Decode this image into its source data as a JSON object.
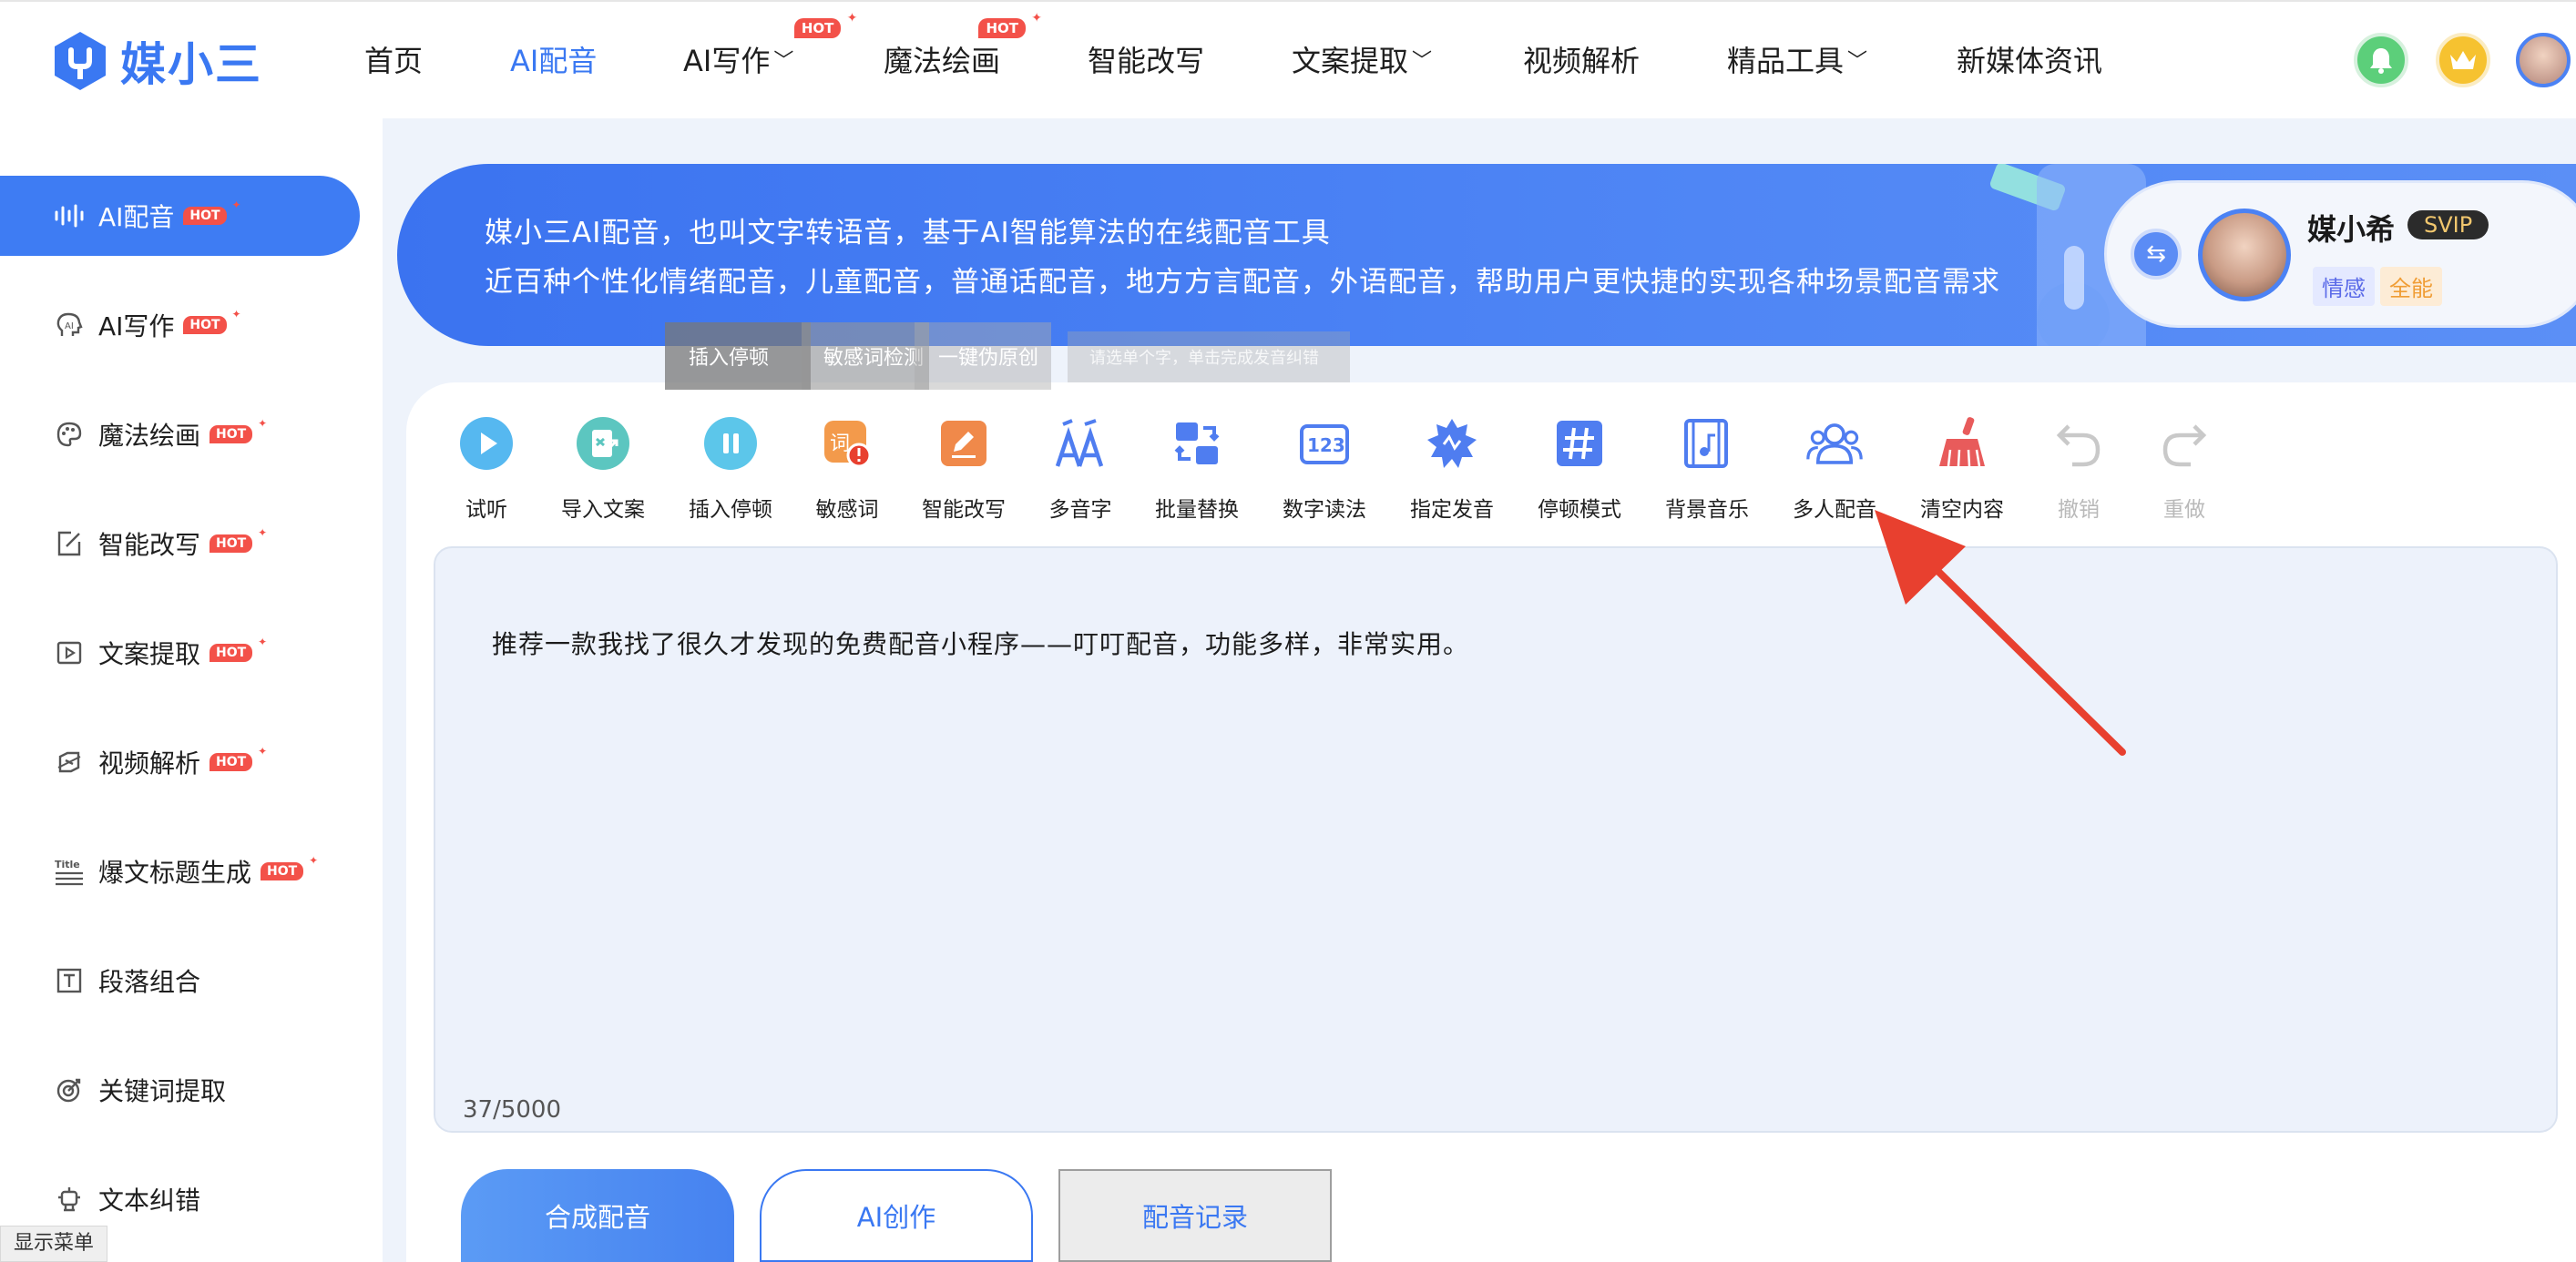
{
  "app": {
    "logo_text": "媒小三"
  },
  "nav": {
    "items": [
      {
        "label": "首页",
        "hot": ""
      },
      {
        "label": "AI配音",
        "hot": ""
      },
      {
        "label": "AI写作",
        "hot": "HOT"
      },
      {
        "label": "魔法绘画",
        "hot": "HOT"
      },
      {
        "label": "智能改写",
        "hot": ""
      },
      {
        "label": "文案提取",
        "hot": ""
      },
      {
        "label": "视频解析",
        "hot": ""
      },
      {
        "label": "精品工具",
        "hot": ""
      },
      {
        "label": "新媒体资讯",
        "hot": ""
      }
    ],
    "active": "AI配音"
  },
  "sidebar": {
    "items": [
      {
        "label": "AI配音",
        "hot": "HOT",
        "icon": "waveform-icon"
      },
      {
        "label": "AI写作",
        "hot": "HOT",
        "icon": "ai-head-icon"
      },
      {
        "label": "魔法绘画",
        "hot": "HOT",
        "icon": "palette-icon"
      },
      {
        "label": "智能改写",
        "hot": "HOT",
        "icon": "edit-icon"
      },
      {
        "label": "文案提取",
        "hot": "HOT",
        "icon": "video-extract-icon"
      },
      {
        "label": "视频解析",
        "hot": "HOT",
        "icon": "video-parse-icon"
      },
      {
        "label": "爆文标题生成",
        "hot": "HOT",
        "icon": "title-icon"
      },
      {
        "label": "段落组合",
        "hot": "",
        "icon": "text-box-icon"
      },
      {
        "label": "关键词提取",
        "hot": "",
        "icon": "target-icon"
      },
      {
        "label": "文本纠错",
        "hot": "",
        "icon": "robot-icon"
      }
    ],
    "show_menu": "显示菜单"
  },
  "banner": {
    "line1": "媒小三AI配音，也叫文字转语音，基于AI智能算法的在线配音工具",
    "line2": "近百种个性化情绪配音，儿童配音，普通话配音，地方方言配音，外语配音，帮助用户更快捷的实现各种场景配音需求"
  },
  "profile": {
    "name": "媒小希",
    "badge": "SVIP",
    "tag1": "情感",
    "tag2": "全能"
  },
  "tooltips": {
    "insert_pause": "插入停顿",
    "sensitive_check": "敏感词检测",
    "rewrite_original": "一键伪原创",
    "faint_hint": "请选单个字，单击完成发音纠错"
  },
  "toolbar": {
    "items": [
      {
        "label": "试听",
        "icon": "play-icon",
        "color": "#56b8f0"
      },
      {
        "label": "导入文案",
        "icon": "import-doc-icon",
        "color": "#5cc6c0"
      },
      {
        "label": "插入停顿",
        "icon": "pause-icon",
        "color": "#5cc6ea"
      },
      {
        "label": "敏感词",
        "icon": "sensitive-word-icon",
        "color": "#f39a4b"
      },
      {
        "label": "智能改写",
        "icon": "pen-icon",
        "color": "#f0894a"
      },
      {
        "label": "多音字",
        "icon": "polyphone-icon",
        "color": "#4f7df0"
      },
      {
        "label": "批量替换",
        "icon": "batch-replace-icon",
        "color": "#4f7df0"
      },
      {
        "label": "数字读法",
        "icon": "number-icon",
        "color": "#4f7df0"
      },
      {
        "label": "指定发音",
        "icon": "pronounce-icon",
        "color": "#4f7df0"
      },
      {
        "label": "停顿模式",
        "icon": "hash-icon",
        "color": "#4f7df0"
      },
      {
        "label": "背景音乐",
        "icon": "music-film-icon",
        "color": "#4f7df0"
      },
      {
        "label": "多人配音",
        "icon": "multi-user-icon",
        "color": "#4f7df0"
      },
      {
        "label": "清空内容",
        "icon": "broom-icon",
        "color": "#e85b5b"
      },
      {
        "label": "撤销",
        "icon": "undo-icon",
        "color": "#c9c9c9"
      },
      {
        "label": "重做",
        "icon": "redo-icon",
        "color": "#c9c9c9"
      }
    ]
  },
  "editor": {
    "text": "推荐一款我找了很久才发现的免费配音小程序——叮叮配音，功能多样，非常实用。",
    "char_count": "37/5000"
  },
  "actions": {
    "synthesize": "合成配音",
    "ai_create": "AI创作",
    "records": "配音记录"
  },
  "colors": {
    "accent": "#3a78f2",
    "hot": "#f35149",
    "annotation_arrow": "#e8402f"
  }
}
